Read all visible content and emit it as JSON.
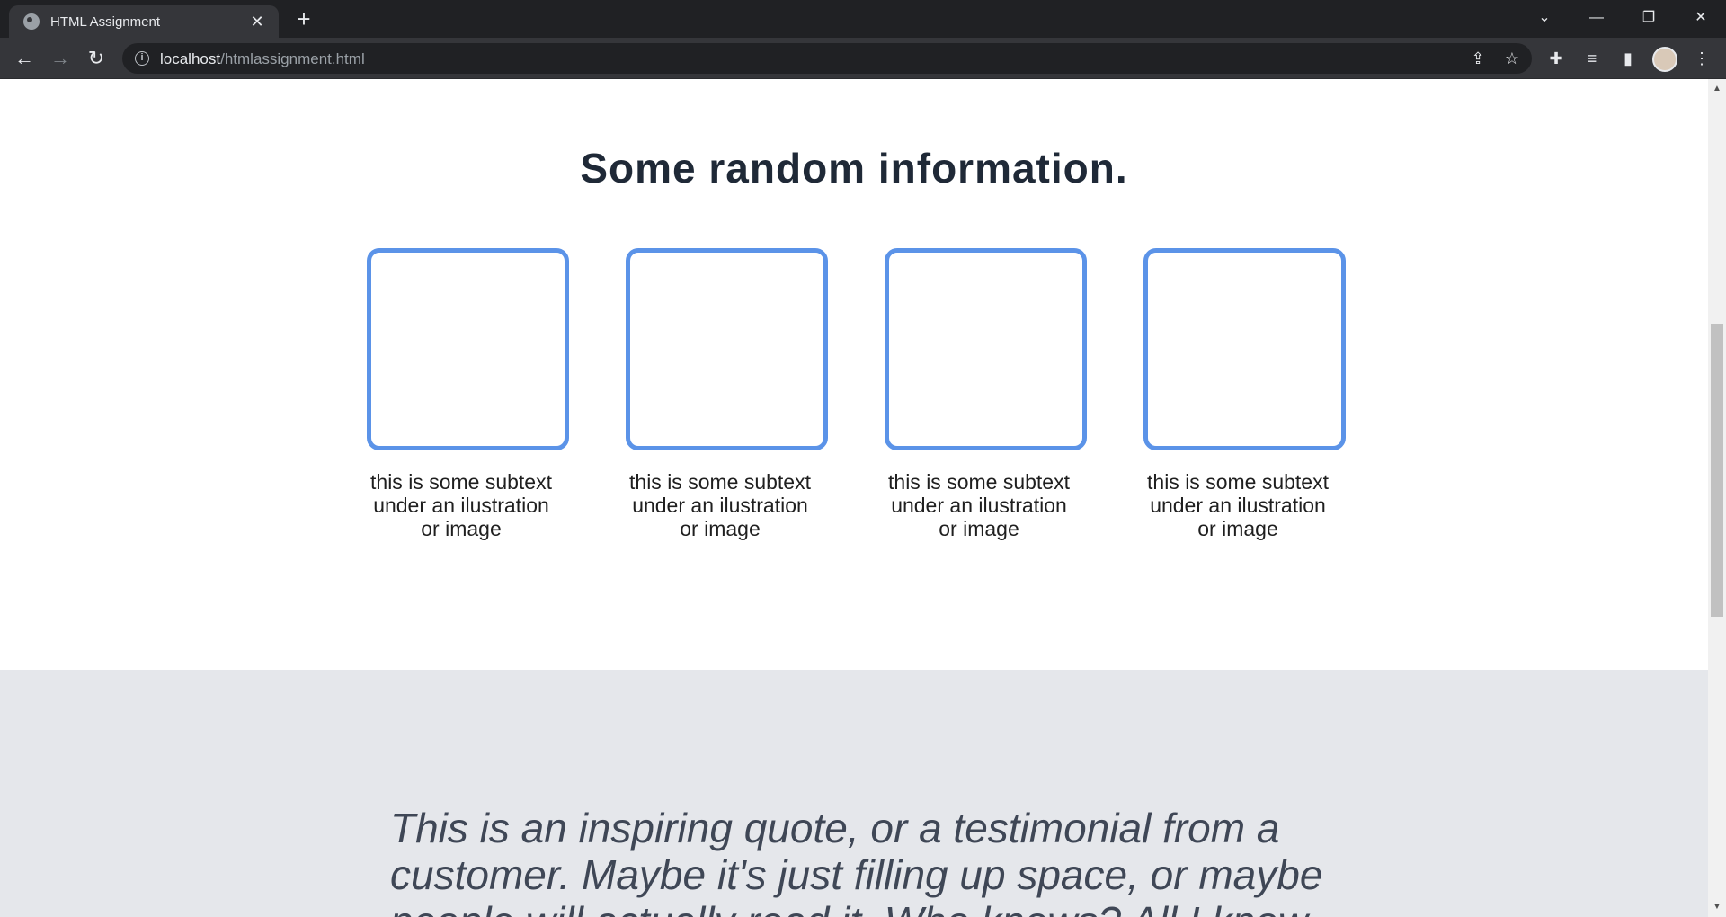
{
  "browser": {
    "tab_title": "HTML Assignment",
    "tab_close": "✕",
    "new_tab": "+",
    "url_host": "localhost",
    "url_path": "/htmlassignment.html",
    "info_icon": "i",
    "back_icon": "←",
    "forward_icon": "→",
    "reload_icon": "↻",
    "dropdown_icon": "⌄",
    "minimize_icon": "—",
    "restore_icon": "❐",
    "close_icon": "✕",
    "share_icon": "⇪",
    "star_icon": "☆",
    "extensions_icon": "✚",
    "media_icon": "≡",
    "sidepanel_icon": "▮",
    "menu_icon": "⋮"
  },
  "scrollbar": {
    "up_arrow": "▲",
    "down_arrow": "▼"
  },
  "info": {
    "heading": "Some random information.",
    "cards": [
      {
        "text": "this is some subtext under an ilustration or image"
      },
      {
        "text": "this is some subtext under an ilustration or image"
      },
      {
        "text": "this is some subtext under an ilustration or image"
      },
      {
        "text": "this is some subtext under an ilustration or image"
      }
    ]
  },
  "quote": {
    "text": "This is an inspiring quote, or a testimonial from a customer. Maybe it's just filling up space, or maybe people will actually read it. Who knows? All I know"
  },
  "colors": {
    "card_border": "#5b93e8",
    "heading": "#1f2937",
    "quote_bg": "#e5e7eb",
    "quote_text": "#3f4756"
  }
}
